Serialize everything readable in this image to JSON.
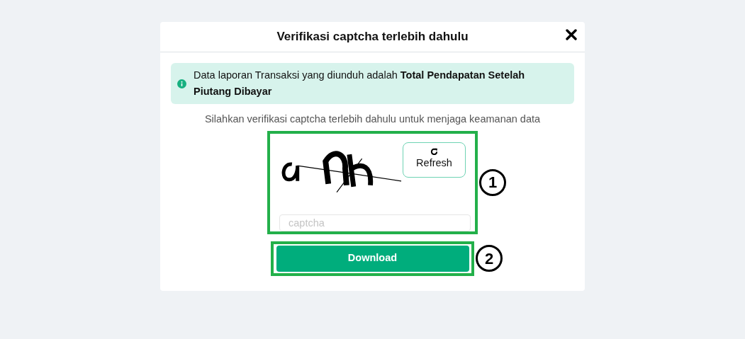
{
  "dialog": {
    "title": "Verifikasi captcha terlebih dahulu"
  },
  "alert": {
    "text": "Data laporan Transaksi yang diunduh adalah **Total Pendapatan Setelah Piutang Dibayar**"
  },
  "instruction": "Silahkan verifikasi captcha terlebih dahulu untuk menjaga keamanan data",
  "captcha": {
    "refresh_label": "Refresh",
    "field": {
      "placeholder": "captcha"
    }
  },
  "download_button": "Download",
  "annotations": [
    {
      "label": "1"
    },
    {
      "label": "2"
    }
  ]
}
